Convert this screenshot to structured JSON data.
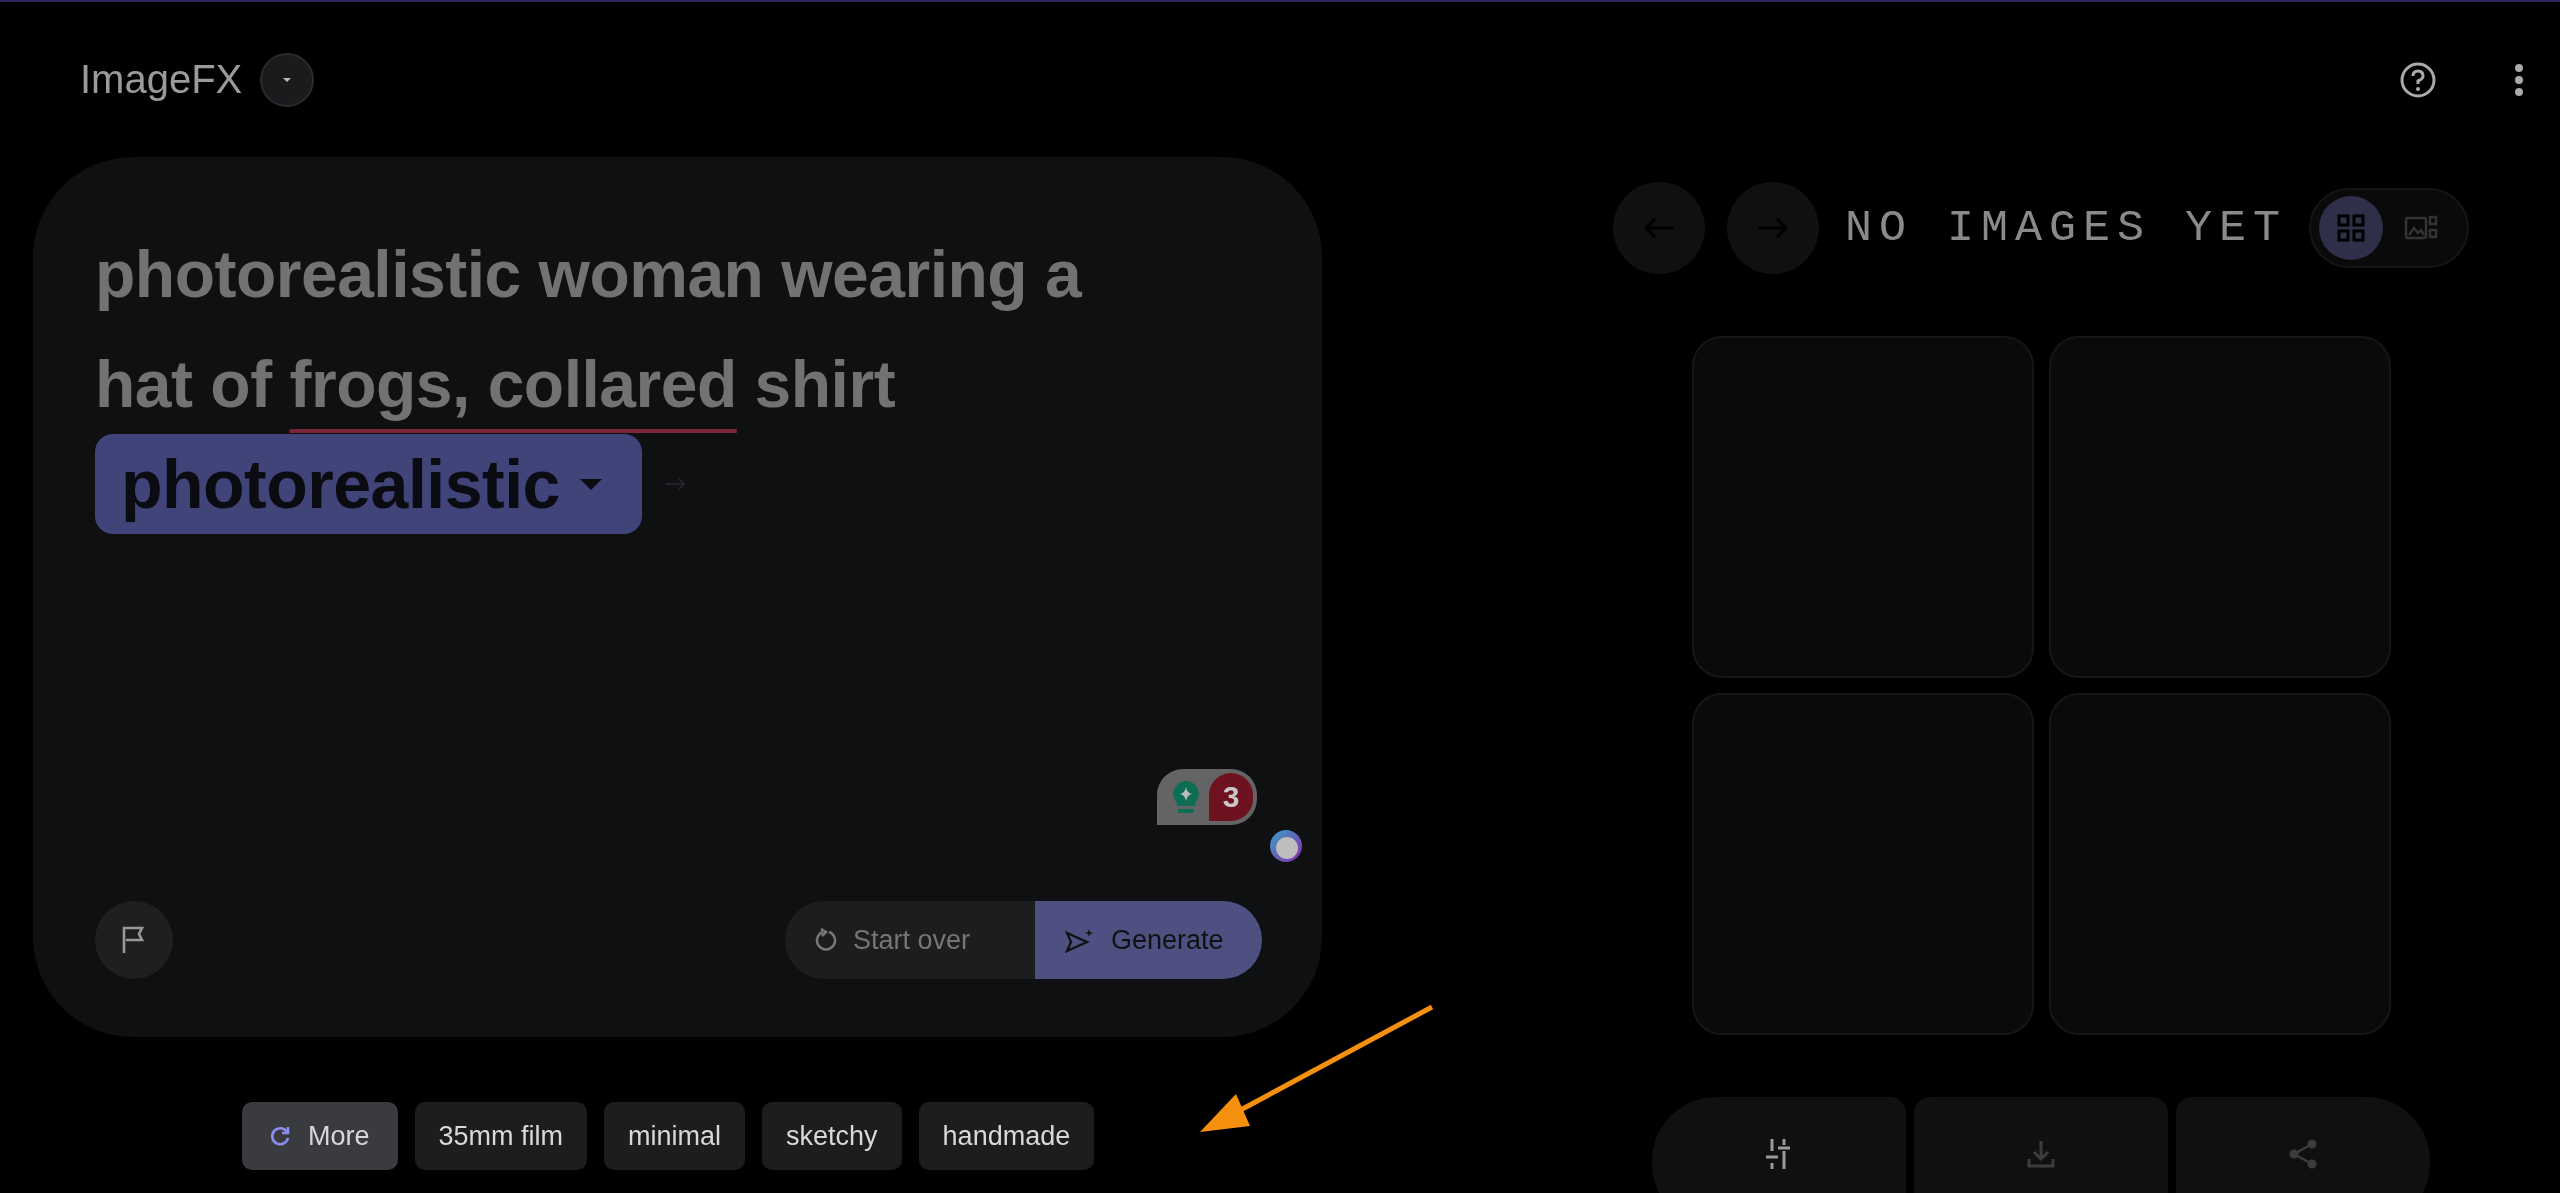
{
  "header": {
    "title": "ImageFX"
  },
  "prompt": {
    "segments": [
      {
        "text": "photorealistic woman wearing a hat of ",
        "underlined": false
      },
      {
        "text": "frogs, collared",
        "underlined": true
      },
      {
        "text": " shirt",
        "underlined": false
      }
    ],
    "style_chip": "photorealistic",
    "badge_count": "3",
    "buttons": [
      "Start over",
      "Generate"
    ]
  },
  "suggestions": [
    {
      "kind": "more",
      "label": "More"
    },
    {
      "kind": "chip",
      "label": "35mm film"
    },
    {
      "kind": "chip",
      "label": "minimal"
    },
    {
      "kind": "chip",
      "label": "sketchy"
    },
    {
      "kind": "chip",
      "label": "handmade"
    }
  ],
  "results": {
    "status": "NO IMAGES YET",
    "view_toggle": [
      {
        "kind": "grid",
        "selected": true
      },
      {
        "kind": "single",
        "selected": false
      }
    ]
  }
}
